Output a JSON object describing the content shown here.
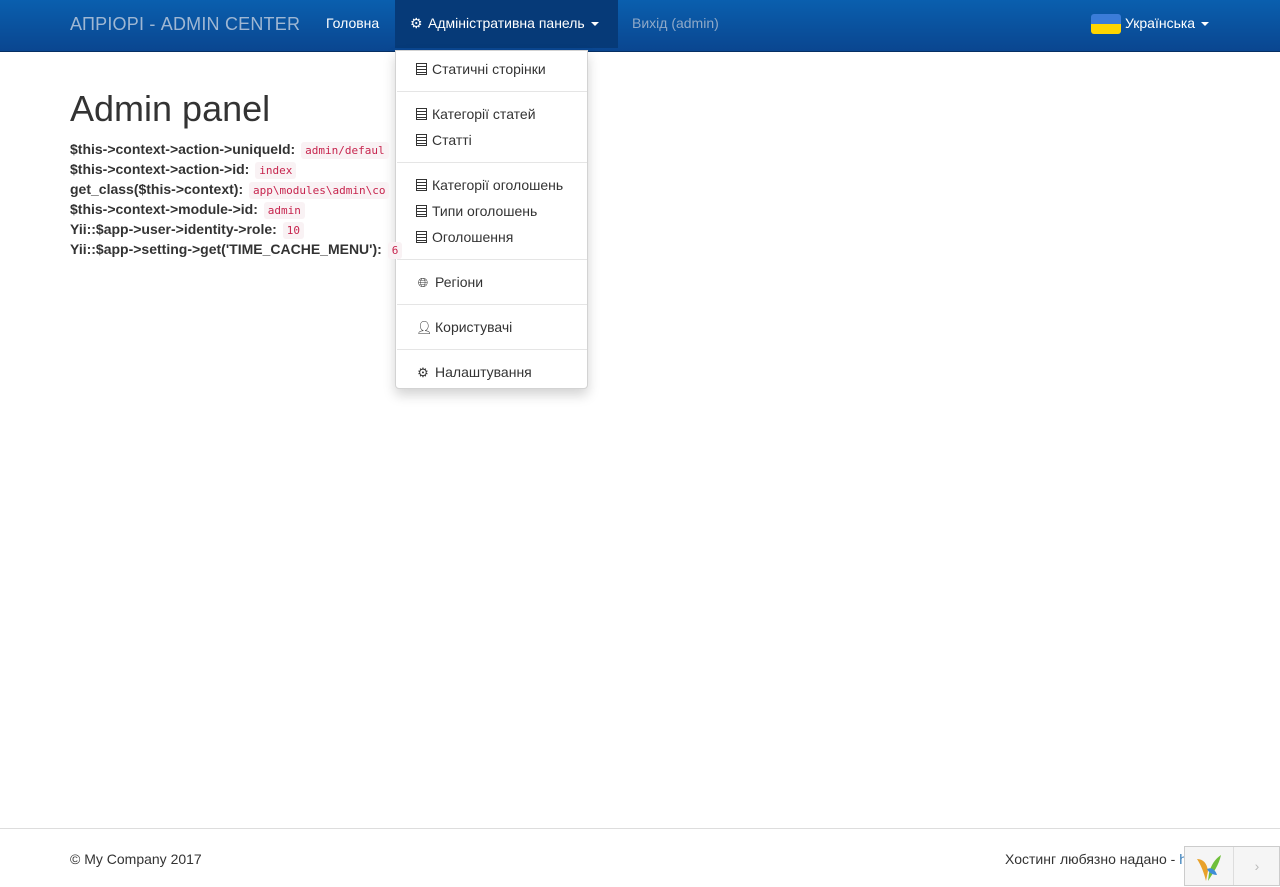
{
  "navbar": {
    "brand": "АПРІОРІ - ADMIN CENTER",
    "home": "Головна",
    "admin_panel": "Адміністративна панель",
    "logout": "Вихід (admin)",
    "language": "Українська"
  },
  "dropdown": {
    "items": [
      {
        "label": "Статичні сторінки",
        "icon": "list-alt-icon"
      },
      {
        "label": "Категорії статей",
        "icon": "list-alt-icon"
      },
      {
        "label": "Статті",
        "icon": "list-alt-icon"
      },
      {
        "label": "Категорії оголошень",
        "icon": "list-alt-icon"
      },
      {
        "label": "Типи оголошень",
        "icon": "list-alt-icon"
      },
      {
        "label": "Оголошення",
        "icon": "list-alt-icon"
      },
      {
        "label": "Регіони",
        "icon": "globe-icon"
      },
      {
        "label": "Користувачі",
        "icon": "user-icon"
      },
      {
        "label": "Налаштування",
        "icon": "gear-icon"
      }
    ]
  },
  "main": {
    "title": "Admin panel",
    "debug": [
      {
        "label": "$this->context->action->uniqueId:",
        "value": "admin/defaul"
      },
      {
        "label": "$this->context->action->id:",
        "value": "index"
      },
      {
        "label": "get_class($this->context):",
        "value": "app\\modules\\admin\\co"
      },
      {
        "label": "$this->context->module->id:",
        "value": "admin"
      },
      {
        "label": "Yii::$app->user->identity->role:",
        "value": "10"
      },
      {
        "label": "Yii::$app->setting->get('TIME_CACHE_MENU'):",
        "value": "6"
      }
    ]
  },
  "footer": {
    "copyright": "© My Company 2017",
    "hosting_text": "Хостинг любязно надано -",
    "hosting_link": "h"
  },
  "colors": {
    "navbar": "#0a4690",
    "active_nav": "#063a78",
    "code_text": "#c7254e",
    "code_bg": "#f9f2f4"
  }
}
